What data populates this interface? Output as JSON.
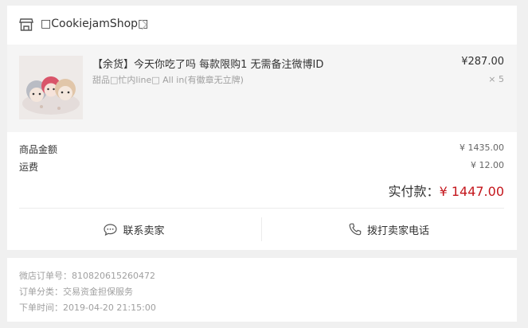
{
  "shop": {
    "name": "□CookiejamShop□",
    "icon": "shop-icon",
    "link_icon": "chevron-right-icon"
  },
  "item": {
    "title": "【余货】今天你吃了吗 每款限购1 无需备注微博ID",
    "spec": "甜品□忙内line□ All in(有徽章无立牌)",
    "price": "¥287.00",
    "quantity": "× 5"
  },
  "summary": {
    "goods_label": "商品金额",
    "goods_value": "¥ 1435.00",
    "shipping_label": "运费",
    "shipping_value": "¥ 12.00",
    "total_label": "实付款：",
    "total_value": "¥ 1447.00"
  },
  "actions": {
    "contact_label": "联系卖家",
    "contact_icon": "chat-bubble-icon",
    "call_label": "拨打卖家电话",
    "call_icon": "phone-icon"
  },
  "meta": {
    "order_no": "微店订单号：810820615260472",
    "category": "订单分类：交易资金担保服务",
    "order_time": "下单时间：2019-04-20 21:15:00"
  },
  "colors": {
    "accent_red": "#c4161c",
    "muted_text": "#a0a0a0",
    "background": "#f0f0f0"
  }
}
